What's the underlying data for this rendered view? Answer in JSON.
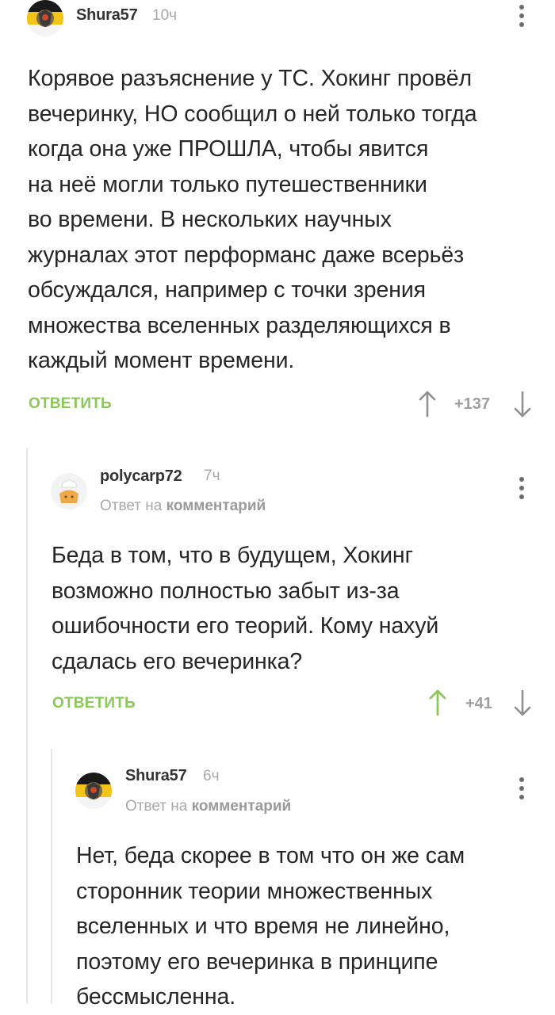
{
  "colors": {
    "accent_green": "#8ac858",
    "muted_gray": "#a8a8a8",
    "text": "#262626"
  },
  "comments": [
    {
      "author": "Shura57",
      "time": "10ч",
      "avatar_icon": "imperial-flag-crest-icon",
      "text_lines": [
        "Корявое разъяснение у ТС. Хокинг провёл",
        "вечеринку, НО сообщил о ней только тогда",
        "когда она уже ПРОШЛА, чтобы явится",
        "на неё могли только путешественники",
        "во времени. В нескольких научных",
        "журналах этот перформанс даже всерьёз",
        "обсуждался, например с точки зрения",
        "множества вселенных разделяющихся в",
        "каждый момент времени."
      ],
      "reply_label": "ОТВЕТИТЬ",
      "rating": "+137"
    },
    {
      "author": "polycarp72",
      "time": "7ч",
      "avatar_icon": "chef-muffin-icon",
      "reply_prefix": "Ответ на",
      "reply_link": "комментарий",
      "text_lines": [
        "Беда в том, что в будущем, Хокинг",
        "возможно полностью забыт из-за",
        "ошибочности его теорий. Кому нахуй",
        "сдалась его вечеринка?"
      ],
      "reply_label": "ОТВЕТИТЬ",
      "rating": "+41"
    },
    {
      "author": "Shura57",
      "time": "6ч",
      "avatar_icon": "imperial-flag-crest-icon",
      "reply_prefix": "Ответ на",
      "reply_link": "комментарий",
      "text_lines": [
        "Нет, беда скорее в том что он же сам",
        "сторонник теории множественных",
        "вселенных и что время не линейно,",
        "поэтому его вечеринка в принципе",
        "бессмысленна."
      ]
    }
  ]
}
